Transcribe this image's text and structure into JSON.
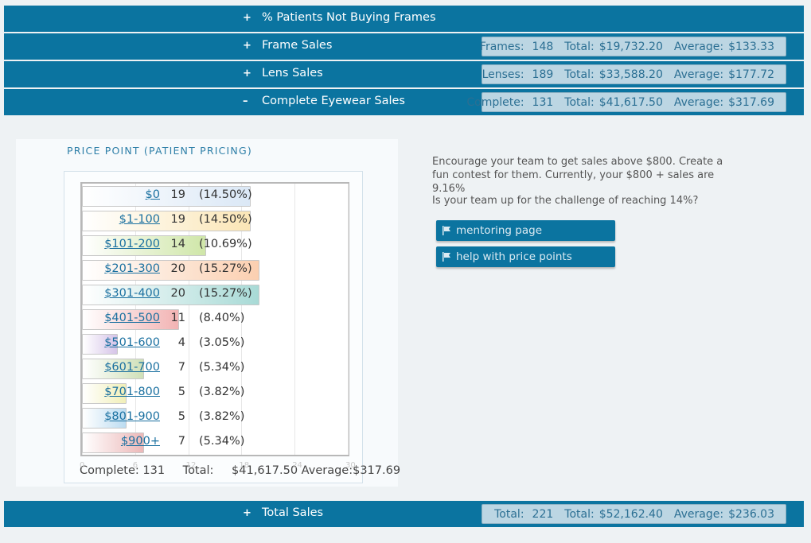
{
  "accordion": [
    {
      "sign": "+",
      "title": "% Patients Not Buying Frames",
      "summary": null
    },
    {
      "sign": "+",
      "title": "Frame Sales",
      "summary": {
        "k1": "Frames:",
        "v1": "148",
        "k2": "Total:",
        "v2": "$19,732.20",
        "k3": "Average:",
        "v3": "$133.33"
      }
    },
    {
      "sign": "+",
      "title": "Lens Sales",
      "summary": {
        "k1": "Lenses:",
        "v1": "189",
        "k2": "Total:",
        "v2": "$33,588.20",
        "k3": "Average:",
        "v3": "$177.72"
      }
    },
    {
      "sign": "–",
      "title": "Complete Eyewear Sales",
      "summary": {
        "k1": "Complete:",
        "v1": "131",
        "k2": "Total:",
        "v2": "$41,617.50",
        "k3": "Average:",
        "v3": "$317.69"
      }
    }
  ],
  "total_sales": {
    "sign": "+",
    "title": "Total Sales",
    "summary": {
      "k1": "Total:",
      "v1": "221",
      "k2": "Total:",
      "v2": "$52,162.40",
      "k3": "Average:",
      "v3": "$236.03"
    }
  },
  "panel": {
    "title": "PRICE POINT (PATIENT PRICING)",
    "footer": {
      "complete": "Complete: 131",
      "total_label": "Total:",
      "total": "$41,617.50",
      "average": "Average:$317.69"
    }
  },
  "chart_data": {
    "type": "bar",
    "orientation": "horizontal",
    "xlim": [
      0,
      30
    ],
    "xticks": [
      "0",
      "6",
      "12",
      "18",
      "24",
      "30"
    ],
    "rows": [
      {
        "label": "$0",
        "value": 19,
        "pct": "(14.50%)",
        "color": "#dbe8f6"
      },
      {
        "label": "$1-100",
        "value": 19,
        "pct": "(14.50%)",
        "color": "#fbe6b6"
      },
      {
        "label": "$101-200",
        "value": 14,
        "pct": "(10.69%)",
        "color": "#cfe6a8"
      },
      {
        "label": "$201-300",
        "value": 20,
        "pct": "(15.27%)",
        "color": "#fbcfb0"
      },
      {
        "label": "$301-400",
        "value": 20,
        "pct": "(15.27%)",
        "color": "#a8dad6"
      },
      {
        "label": "$401-500",
        "value": 11,
        "pct": "(8.40%)",
        "color": "#f2b3b3"
      },
      {
        "label": "$501-600",
        "value": 4,
        "pct": "(3.05%)",
        "color": "#d6c4e8"
      },
      {
        "label": "$601-700",
        "value": 7,
        "pct": "(5.34%)",
        "color": "#cfe0b8"
      },
      {
        "label": "$701-800",
        "value": 5,
        "pct": "(3.82%)",
        "color": "#f1efb8"
      },
      {
        "label": "$801-900",
        "value": 5,
        "pct": "(3.82%)",
        "color": "#bcdcf1"
      },
      {
        "label": "$900+",
        "value": 7,
        "pct": "(5.34%)",
        "color": "#ecb8b8"
      }
    ]
  },
  "message": {
    "p1": "Encourage your team to get sales above $800. Create a fun contest for them. Currently, your $800 + sales are 9.16%",
    "p2": "Is your team up for the challenge of reaching 14%?"
  },
  "buttons": {
    "mentoring": "mentoring page",
    "help": "help with price points"
  },
  "icons": {
    "sign": "plus-minus",
    "button": "flag-icon"
  }
}
